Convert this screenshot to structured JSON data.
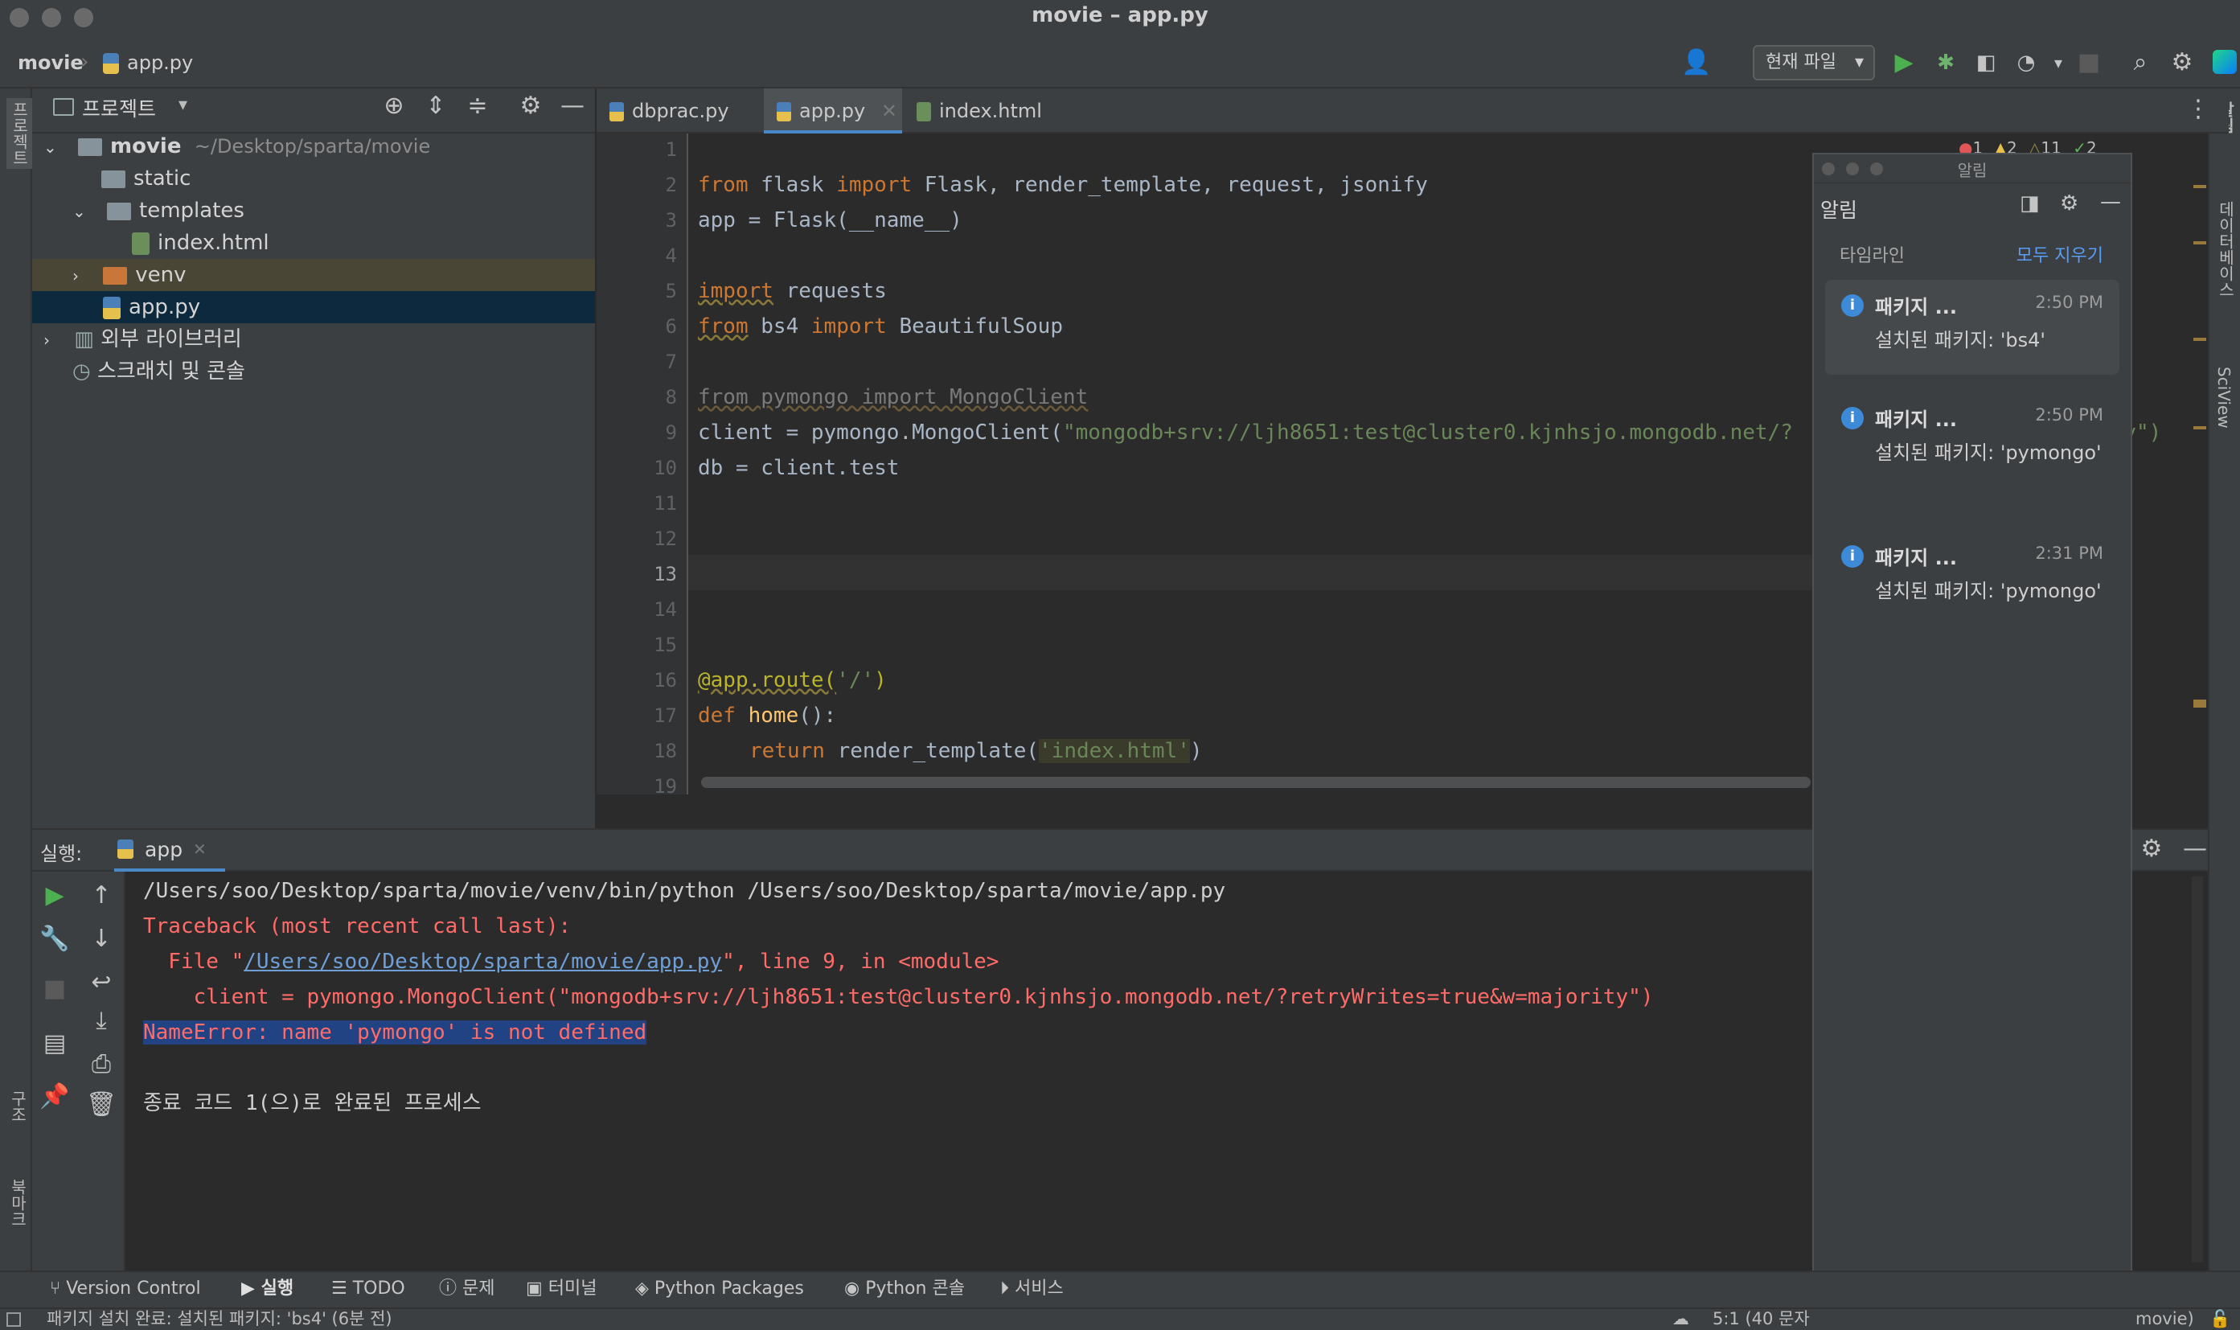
{
  "window": {
    "title": "movie – app.py"
  },
  "breadcrumb": {
    "project": "movie",
    "file": "app.py"
  },
  "toolbar": {
    "run_config": "현재 파일"
  },
  "project_panel": {
    "title": "프로젝트",
    "tree": [
      {
        "label": "movie",
        "path": "~/Desktop/sparta/movie"
      },
      {
        "label": "static"
      },
      {
        "label": "templates"
      },
      {
        "label": "index.html"
      },
      {
        "label": "venv"
      },
      {
        "label": "app.py"
      },
      {
        "label": "외부 라이브러리"
      },
      {
        "label": "스크래치 및 콘솔"
      }
    ]
  },
  "editor": {
    "tabs": [
      {
        "label": "dbprac.py"
      },
      {
        "label": "app.py"
      },
      {
        "label": "index.html"
      }
    ],
    "inspection": {
      "errors": "1",
      "warnings": "2",
      "weak_warnings": "11",
      "ok": "2"
    },
    "line_numbers": [
      "1",
      "2",
      "3",
      "4",
      "5",
      "6",
      "7",
      "8",
      "9",
      "10",
      "11",
      "12",
      "13",
      "14",
      "15",
      "16",
      "17",
      "18",
      "19"
    ],
    "lines": {
      "l2": {
        "kw1": "from",
        "mod": " flask ",
        "kw2": "import",
        "rest": " Flask, render_template, request, jsonify"
      },
      "l3": "app = Flask(__name__)",
      "l5": {
        "kw": "import",
        "rest": " requests"
      },
      "l6": {
        "kw1": "from",
        "mod": " bs4 ",
        "kw2": "import",
        "rest": " BeautifulSoup"
      },
      "l8": "from pymongo import MongoClient",
      "l9": {
        "pre": "client = pymongo.MongoClient(",
        "str": "\"mongodb+srv://ljh8651:test@cluster0.kjnhsjo.mongodb.net/?",
        "tail": "ity\")"
      },
      "l10": "db = client.test",
      "l16": {
        "dec": "@app.route(",
        "str": "'/'",
        "close": ")"
      },
      "l17": {
        "kw": "def",
        "fn": " home",
        "rest": "():"
      },
      "l18": {
        "kw": "return",
        "pre": " render_template(",
        "str": "'index.html'",
        "close": ")"
      }
    }
  },
  "run": {
    "label": "실행:",
    "tab": "app",
    "console": {
      "cmd": "/Users/soo/Desktop/sparta/movie/venv/bin/python /Users/soo/Desktop/sparta/movie/app.py",
      "tb": "Traceback (most recent call last):",
      "file_pre": "  File \"",
      "file_link": "/Users/soo/Desktop/sparta/movie/app.py",
      "file_post": "\", line 9, in <module>",
      "code": "    client = pymongo.MongoClient(\"mongodb+srv://ljh8651:test@cluster0.kjnhsjo.mongodb.net/?retryWrites=true&w=majority\")",
      "error": "NameError: name 'pymongo' is not defined",
      "exit": "종료 코드 1(으)로 완료된 프로세스"
    }
  },
  "notifications": {
    "title_bar": "알림",
    "header": "알림",
    "timeline": "타임라인",
    "clear_all": "모두 지우기",
    "items": [
      {
        "title": "패키지 ...",
        "time": "2:50 PM",
        "body": "설치된 패키지: 'bs4'"
      },
      {
        "title": "패키지 ...",
        "time": "2:50 PM",
        "body": "설치된 패키지: 'pymongo'"
      },
      {
        "title": "패키지 ...",
        "time": "2:31 PM",
        "body": "설치된 패키지: 'pymongo'"
      }
    ]
  },
  "bottom_tabs": [
    "Version Control",
    "실행",
    "TODO",
    "문제",
    "터미널",
    "Python Packages",
    "Python 콘솔",
    "서비스"
  ],
  "status_bar": {
    "message": "패키지 설치 완료: 설치된 패키지: 'bs4' (6분 전)",
    "position": "5:1 (40 문자",
    "interpreter": "movie)"
  },
  "side_strips": {
    "left_top": "프로젝트",
    "left_mid": "구조",
    "left_bottom": "북마크",
    "right_top": "알림",
    "right_db": "데이터베이스",
    "right_sci": "SciView"
  },
  "colors": {
    "keyword": "#cc7832",
    "string": "#6a8759",
    "decorator": "#bbb529",
    "error": "#ff6b68",
    "run": "#4caf50",
    "selection": "#214283"
  }
}
